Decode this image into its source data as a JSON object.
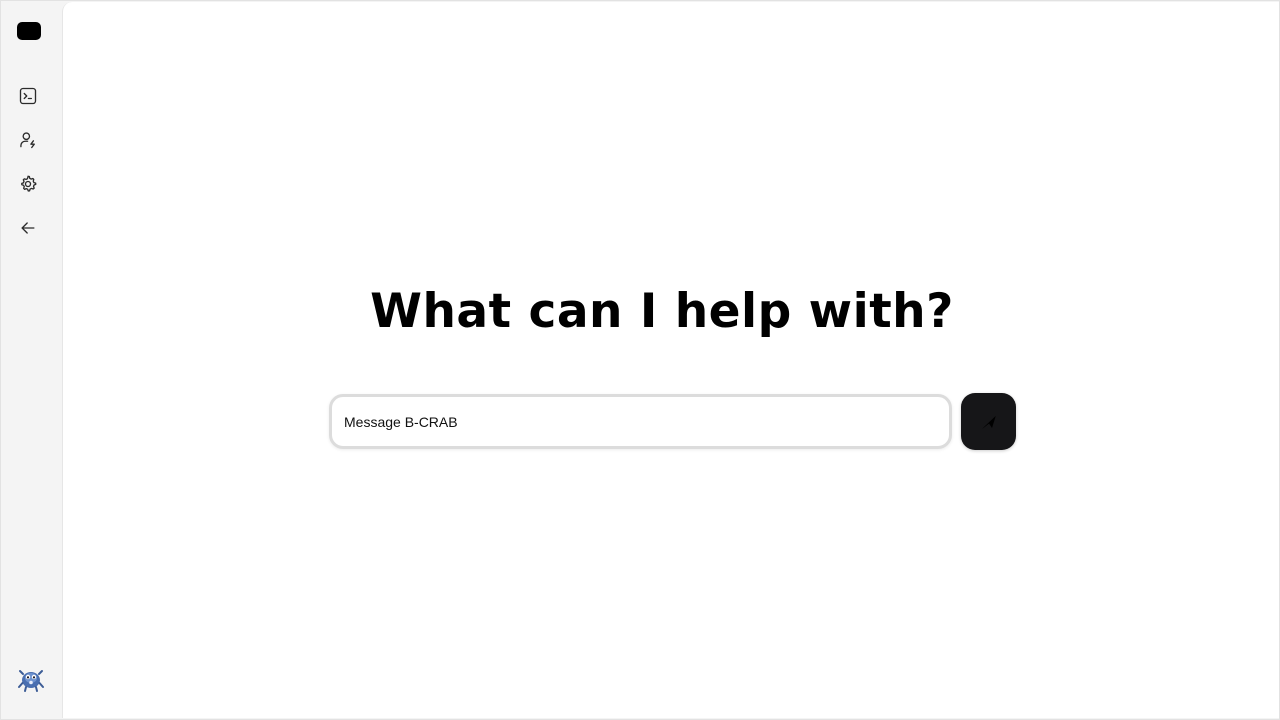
{
  "sidebar": {
    "items": [
      {
        "icon": "terminal-icon",
        "label": "Terminal"
      },
      {
        "icon": "user-bolt-icon",
        "label": "Agents"
      },
      {
        "icon": "gear-icon",
        "label": "Settings"
      },
      {
        "icon": "arrow-left-icon",
        "label": "Back"
      }
    ],
    "avatar_icon": "crab-avatar-icon"
  },
  "main": {
    "headline": "What can I help with?",
    "composer": {
      "placeholder": "Message B-CRAB",
      "value": ""
    },
    "send_icon": "send-icon"
  },
  "colors": {
    "sidebar_bg": "#f4f4f4",
    "main_bg": "#ffffff",
    "send_button_bg": "#161618",
    "avatar": "#4a6fb0"
  }
}
